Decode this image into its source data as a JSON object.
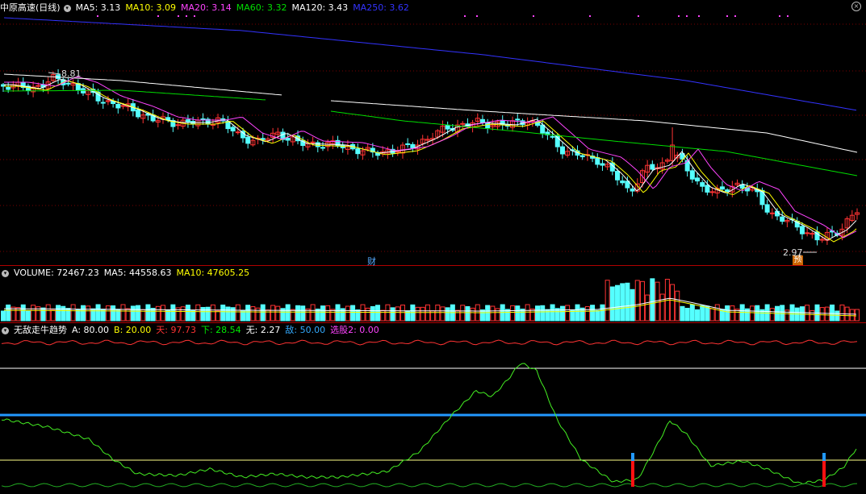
{
  "main_header": {
    "title": "中原高速(日线)",
    "items": [
      {
        "label": "MA5: 3.13",
        "color": "#ffffff"
      },
      {
        "label": "MA10: 3.09",
        "color": "#ffff00"
      },
      {
        "label": "MA20: 3.14",
        "color": "#ff44ff"
      },
      {
        "label": "MA60: 3.32",
        "color": "#00dd00"
      },
      {
        "label": "MA120: 3.43",
        "color": "#ffffff"
      },
      {
        "label": "MA250: 3.62",
        "color": "#3333ff"
      }
    ]
  },
  "volume_header": {
    "items": [
      {
        "label": "VOLUME: 72467.23",
        "color": "#ffffff"
      },
      {
        "label": "MA5: 44558.63",
        "color": "#ffffff"
      },
      {
        "label": "MA10: 47605.25",
        "color": "#ffff00"
      }
    ]
  },
  "indicator_header": {
    "title": "无敌走牛趋势",
    "items": [
      {
        "label": "A: 80.00",
        "color": "#ffffff"
      },
      {
        "label": "B: 20.00",
        "color": "#ffff00"
      },
      {
        "label": "天: 97.73",
        "color": "#ff3333"
      },
      {
        "label": "下: 28.54",
        "color": "#00ee00"
      },
      {
        "label": "无: 2.27",
        "color": "#ffffff"
      },
      {
        "label": "敌: 50.00",
        "color": "#33aaff"
      },
      {
        "label": "选股2: 0.00",
        "color": "#ff44ff"
      }
    ]
  },
  "annotations": {
    "high": "8.81",
    "low": "2.97",
    "cai": "财",
    "yu": "预"
  },
  "colors": {
    "up": "#ff3333",
    "down": "#55ffff",
    "separator": "#b00000"
  },
  "chart_data": {
    "type": "candlestick",
    "ma_lines": [
      "MA5",
      "MA10",
      "MA20",
      "MA60",
      "MA120",
      "MA250"
    ],
    "indicator_levels": {
      "A": 80,
      "B": 20,
      "敌": 50
    }
  }
}
